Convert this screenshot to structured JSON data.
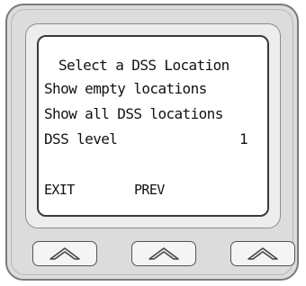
{
  "display": {
    "title": "Select a DSS Location",
    "menu_items": [
      {
        "label": "Show empty locations"
      },
      {
        "label": "Show all DSS locations"
      },
      {
        "label": "DSS level",
        "value": "1"
      }
    ],
    "softkey_labels": [
      "EXIT",
      "PREV"
    ]
  },
  "softkeys": [
    {
      "icon": "chevron-up-icon"
    },
    {
      "icon": "chevron-up-icon"
    },
    {
      "icon": "chevron-up-icon"
    }
  ],
  "colors": {
    "body": "#dcdcdc",
    "bezel": "#ededed",
    "screen": "#ffffff",
    "text": "#111111"
  }
}
